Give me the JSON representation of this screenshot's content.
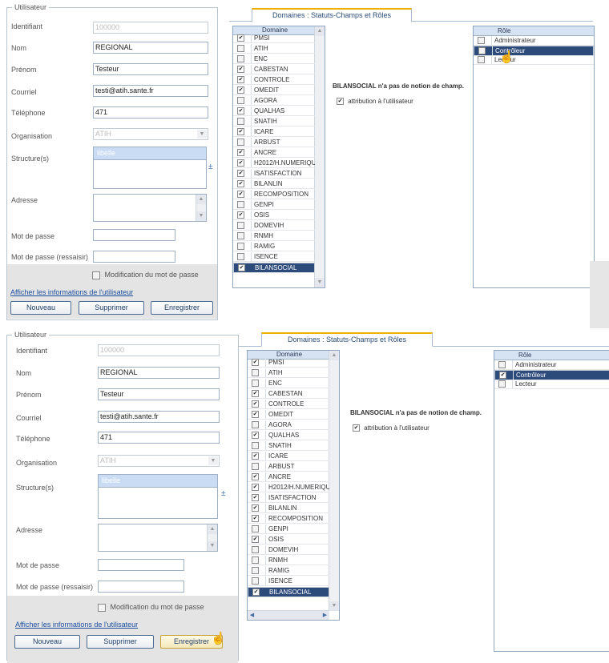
{
  "form": {
    "legend": "Utilisateur",
    "labels": {
      "identifiant": "Identifiant",
      "nom": "Nom",
      "prenom": "Prénom",
      "courriel": "Courriel",
      "telephone": "Téléphone",
      "organisation": "Organisation",
      "structures": "Structure(s)",
      "adresse": "Adresse",
      "mot_de_passe": "Mot de passe",
      "mot_de_passe_ressaisir": "Mot de passe (ressaisir)"
    },
    "values": {
      "identifiant": "100000",
      "nom": "REGIONAL",
      "prenom": "Testeur",
      "courriel": "testi@atih.sante.fr",
      "telephone": "471",
      "organisation": "ATIH"
    },
    "structure_header": "libelle",
    "add_symbol": "±",
    "modif_label": "Modification du mot de passe",
    "link": "Afficher les informations de l'utilisateur",
    "buttons": {
      "nouveau": "Nouveau",
      "supprimer": "Supprimer",
      "enregistrer": "Enregistrer"
    }
  },
  "tab_label": "Domaines : Statuts-Champs et Rôles",
  "domain_header": "Domaine",
  "domains": [
    {
      "name": "PMSI",
      "checked": true
    },
    {
      "name": "ATIH",
      "checked": false
    },
    {
      "name": "ENC",
      "checked": false
    },
    {
      "name": "CABESTAN",
      "checked": true
    },
    {
      "name": "CONTROLE",
      "checked": true
    },
    {
      "name": "OMEDIT",
      "checked": true
    },
    {
      "name": "AGORA",
      "checked": false
    },
    {
      "name": "QUALHAS",
      "checked": true
    },
    {
      "name": "SNATIH",
      "checked": false
    },
    {
      "name": "ICARE",
      "checked": true
    },
    {
      "name": "ARBUST",
      "checked": false
    },
    {
      "name": "ANCRE",
      "checked": true
    },
    {
      "name": "H2012/H.NUMERIQUE",
      "checked": true
    },
    {
      "name": "ISATISFACTION",
      "checked": true
    },
    {
      "name": "BILANLIN",
      "checked": true
    },
    {
      "name": "RECOMPOSITION",
      "checked": true
    },
    {
      "name": "GENPI",
      "checked": false
    },
    {
      "name": "OSIS",
      "checked": true
    },
    {
      "name": "DOMEVIH",
      "checked": false
    },
    {
      "name": "RNMH",
      "checked": false
    },
    {
      "name": "RAMIG",
      "checked": false
    },
    {
      "name": "ISENCE",
      "checked": false
    },
    {
      "name": "BILANSOCIAL",
      "checked": true,
      "selected": true
    }
  ],
  "info_message": "BILANSOCIAL n'a pas de notion de champ.",
  "attribution_label": "attribution à l'utilisateur",
  "roles_header": "Rôle",
  "roles_top": [
    {
      "name": "Administrateur",
      "checked": false,
      "selected": false
    },
    {
      "name": "Contrôleur",
      "checked": false,
      "selected": true
    },
    {
      "name": "Lecteur",
      "checked": false,
      "selected": false
    }
  ],
  "roles_bottom": [
    {
      "name": "Administrateur",
      "checked": false,
      "selected": false
    },
    {
      "name": "Contrôleur",
      "checked": true,
      "selected": true
    },
    {
      "name": "Lecteur",
      "checked": false,
      "selected": false
    }
  ],
  "icons": {
    "check": "✔",
    "up": "▲",
    "down": "▼",
    "left": "◀",
    "right": "▶",
    "hand": "☝"
  }
}
